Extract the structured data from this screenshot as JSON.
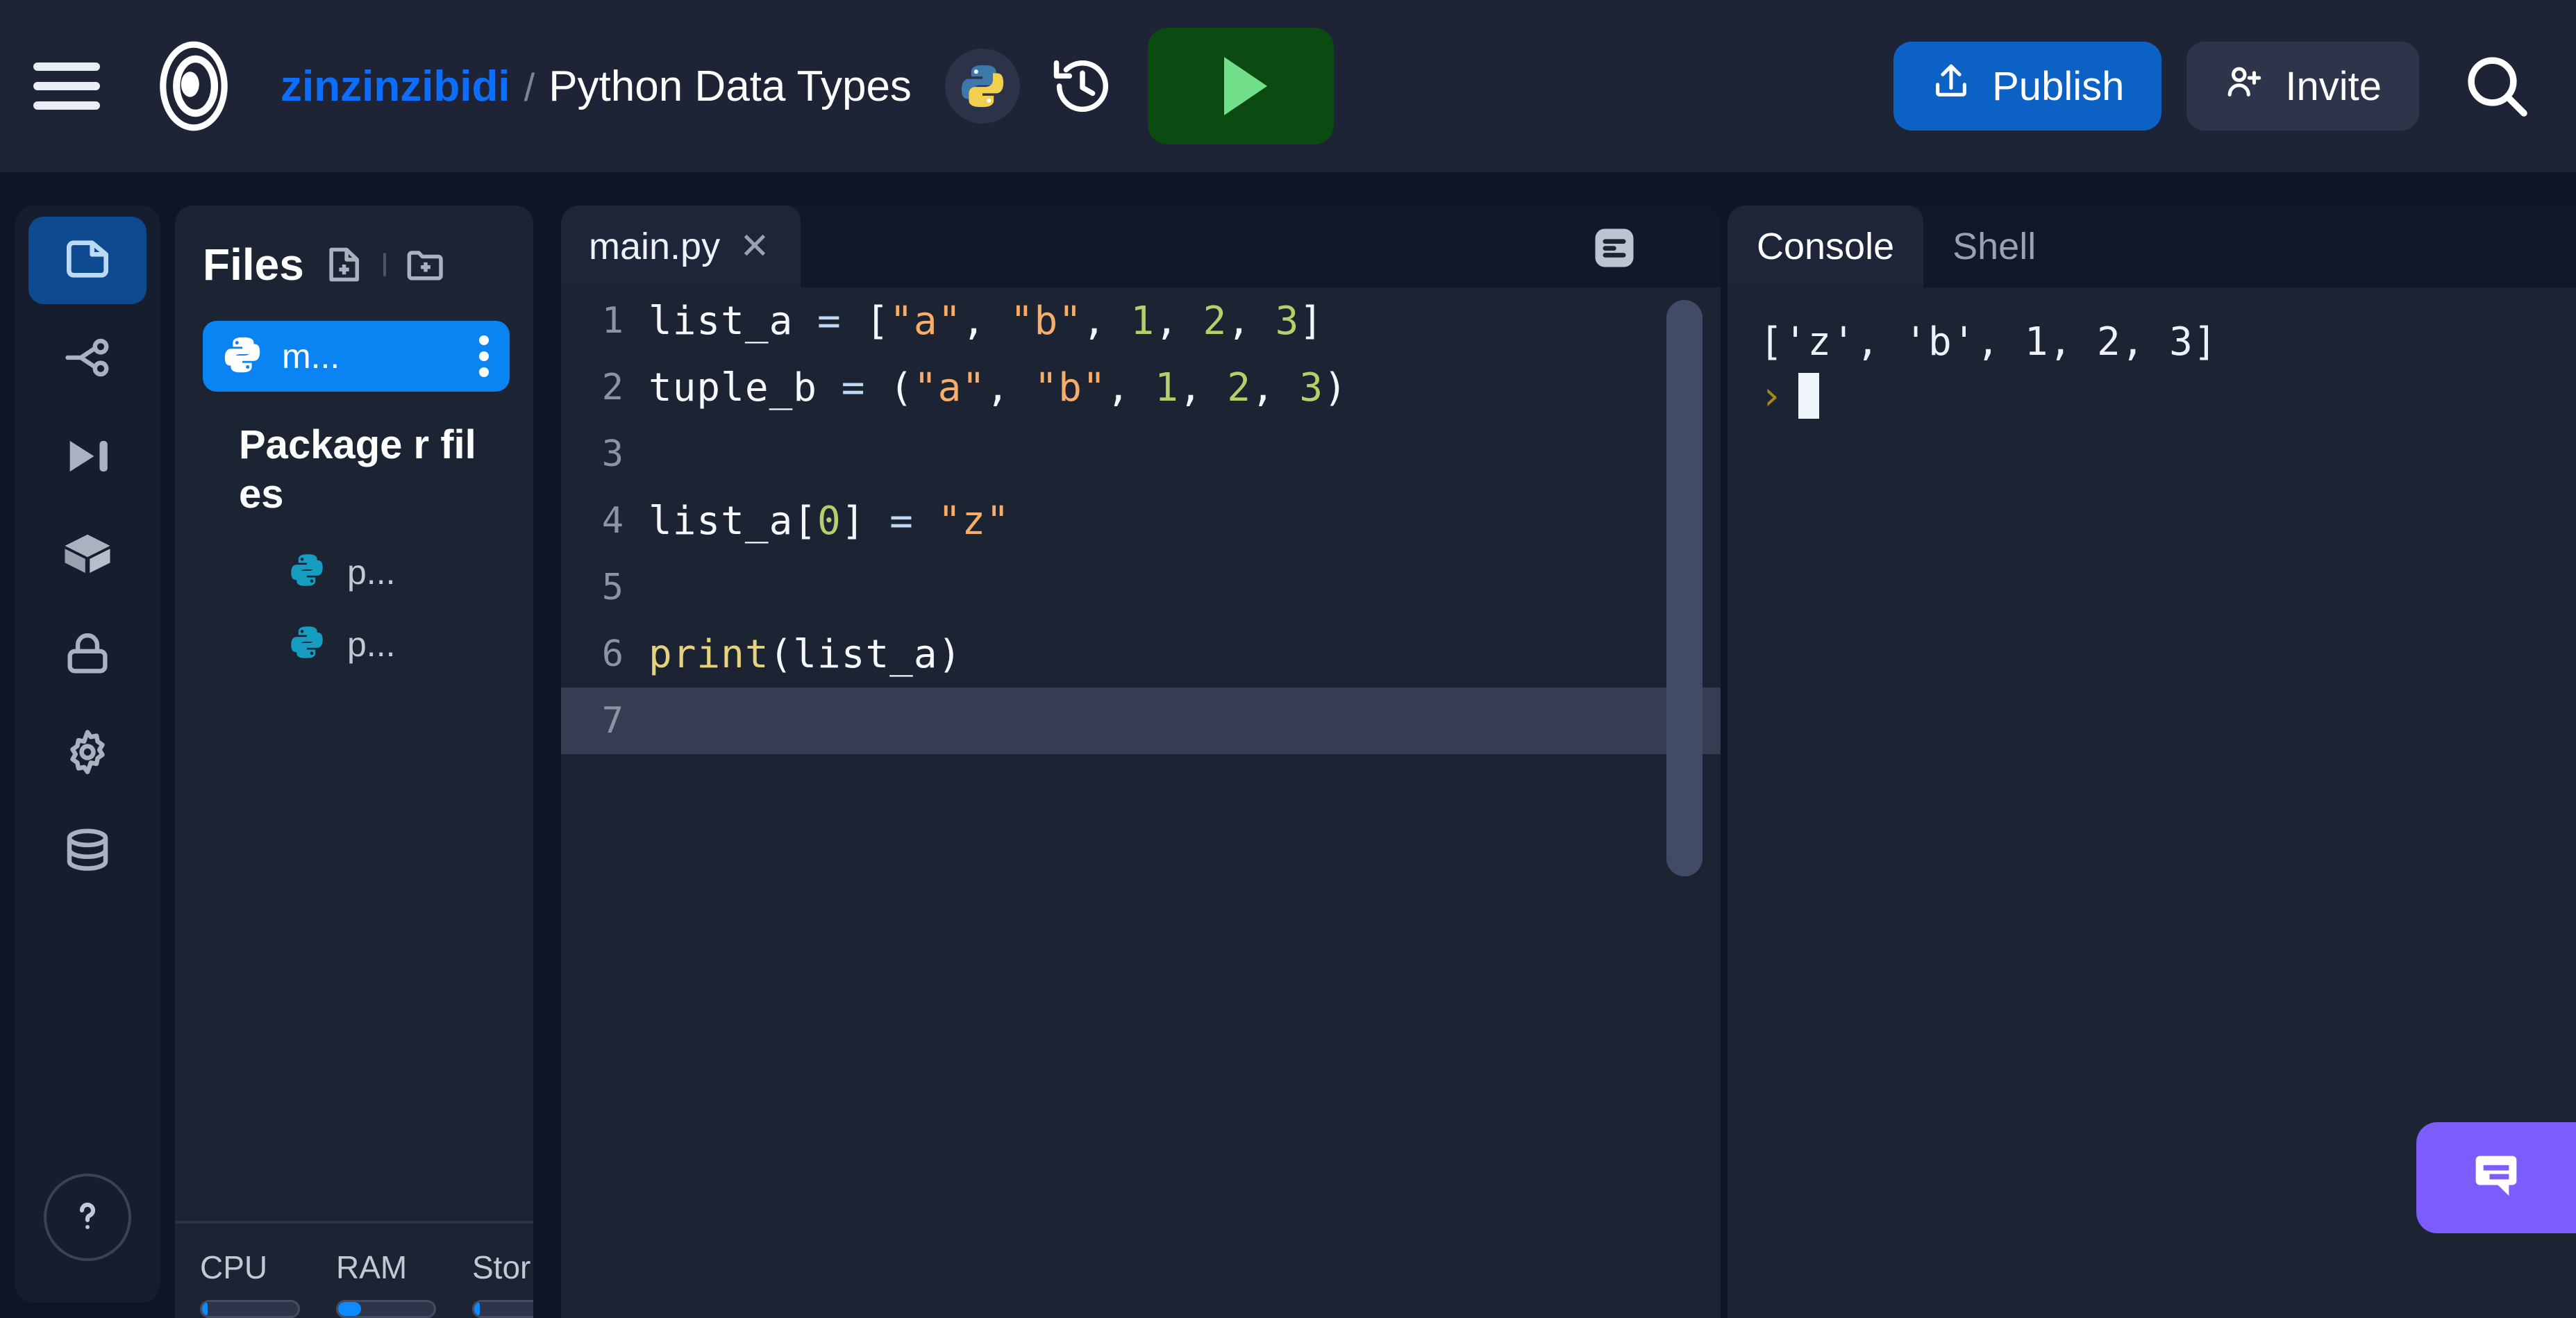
{
  "header": {
    "menu_icon": "hamburger-menu-icon",
    "logo_icon": "replit-logo-icon",
    "owner": "zinzinzibidi",
    "separator": "/",
    "project_title": "Python Data Types",
    "language_icon": "python-logo-icon",
    "history_icon": "history-clock-icon",
    "run_label": "",
    "run_icon": "play-triangle-icon",
    "publish_label": "Publish",
    "publish_icon": "upload-icon",
    "invite_label": "Invite",
    "invite_icon": "user-plus-icon",
    "search_icon": "search-icon",
    "publish_color": "#0b62c4",
    "invite_color": "#2e3449",
    "run_color": "#0b4a10",
    "owner_color": "#0d6efd"
  },
  "rail": {
    "items": [
      {
        "icon": "files-document-icon",
        "name": "sidebar-item-files",
        "active": true
      },
      {
        "icon": "git-branch-icon",
        "name": "sidebar-item-git",
        "active": false
      },
      {
        "icon": "run-step-icon",
        "name": "sidebar-item-debugger",
        "active": false
      },
      {
        "icon": "package-box-icon",
        "name": "sidebar-item-packages",
        "active": false
      },
      {
        "icon": "lock-icon",
        "name": "sidebar-item-secrets",
        "active": false
      },
      {
        "icon": "gear-icon",
        "name": "sidebar-item-settings",
        "active": false
      },
      {
        "icon": "database-icon",
        "name": "sidebar-item-database",
        "active": false
      }
    ],
    "help": {
      "icon": "question-mark-icon",
      "name": "sidebar-item-help"
    }
  },
  "files": {
    "title": "Files",
    "new_file_icon": "new-file-icon",
    "new_folder_icon": "new-folder-icon",
    "selected_file": "m...",
    "selected_file_icon": "python-file-icon",
    "kebab_icon": "kebab-menu-icon",
    "packager_label": "Package\nr files",
    "children": [
      {
        "name": "p...",
        "icon": "python-file-icon"
      },
      {
        "name": "p...",
        "icon": "python-file-icon"
      }
    ],
    "resources": [
      {
        "label": "CPU",
        "fill_pct": 6
      },
      {
        "label": "RAM",
        "fill_pct": 24
      },
      {
        "label": "Stor",
        "fill_pct": 6
      }
    ],
    "accent_selected": "#0b84f3"
  },
  "editor": {
    "tab_label": "main.py",
    "tab_close_icon": "close-icon",
    "format_icon": "format-lines-icon",
    "active_line": 7,
    "lines": [
      {
        "n": "1",
        "tokens": [
          {
            "t": "list_a ",
            "c": "ident"
          },
          {
            "t": "=",
            "c": "op"
          },
          {
            "t": " [",
            "c": "ident"
          },
          {
            "t": "\"a\"",
            "c": "str"
          },
          {
            "t": ", ",
            "c": "ident"
          },
          {
            "t": "\"b\"",
            "c": "str"
          },
          {
            "t": ", ",
            "c": "ident"
          },
          {
            "t": "1",
            "c": "num"
          },
          {
            "t": ", ",
            "c": "ident"
          },
          {
            "t": "2",
            "c": "num"
          },
          {
            "t": ", ",
            "c": "ident"
          },
          {
            "t": "3",
            "c": "num"
          },
          {
            "t": "]",
            "c": "ident"
          }
        ]
      },
      {
        "n": "2",
        "tokens": [
          {
            "t": "tuple_b ",
            "c": "ident"
          },
          {
            "t": "=",
            "c": "op"
          },
          {
            "t": " (",
            "c": "ident"
          },
          {
            "t": "\"a\"",
            "c": "str"
          },
          {
            "t": ", ",
            "c": "ident"
          },
          {
            "t": "\"b\"",
            "c": "str"
          },
          {
            "t": ", ",
            "c": "ident"
          },
          {
            "t": "1",
            "c": "num"
          },
          {
            "t": ", ",
            "c": "ident"
          },
          {
            "t": "2",
            "c": "num"
          },
          {
            "t": ", ",
            "c": "ident"
          },
          {
            "t": "3",
            "c": "num"
          },
          {
            "t": ")",
            "c": "ident"
          }
        ]
      },
      {
        "n": "3",
        "tokens": []
      },
      {
        "n": "4",
        "tokens": [
          {
            "t": "list_a[",
            "c": "ident"
          },
          {
            "t": "0",
            "c": "num"
          },
          {
            "t": "] ",
            "c": "ident"
          },
          {
            "t": "=",
            "c": "op"
          },
          {
            "t": " ",
            "c": "ident"
          },
          {
            "t": "\"z\"",
            "c": "str"
          }
        ]
      },
      {
        "n": "5",
        "tokens": []
      },
      {
        "n": "6",
        "tokens": [
          {
            "t": "print",
            "c": "fn"
          },
          {
            "t": "(list_a)",
            "c": "ident"
          }
        ]
      },
      {
        "n": "7",
        "tokens": []
      }
    ],
    "colors": {
      "string": "#f8ae68",
      "number": "#b5d06a",
      "function": "#e6d27a",
      "operator": "#bcd9f5",
      "identifier": "#f5f7fb"
    }
  },
  "console": {
    "tabs": [
      {
        "label": "Console",
        "active": true
      },
      {
        "label": "Shell",
        "active": false
      }
    ],
    "output": "['z', 'b', 1, 2, 3]",
    "prompt": "›",
    "cursor": "block-cursor"
  },
  "chat": {
    "icon": "chat-bubble-icon",
    "color": "#7c5cfa"
  },
  "grips": {
    "files_editor": "resize-grip",
    "editor_console": "resize-grip"
  }
}
